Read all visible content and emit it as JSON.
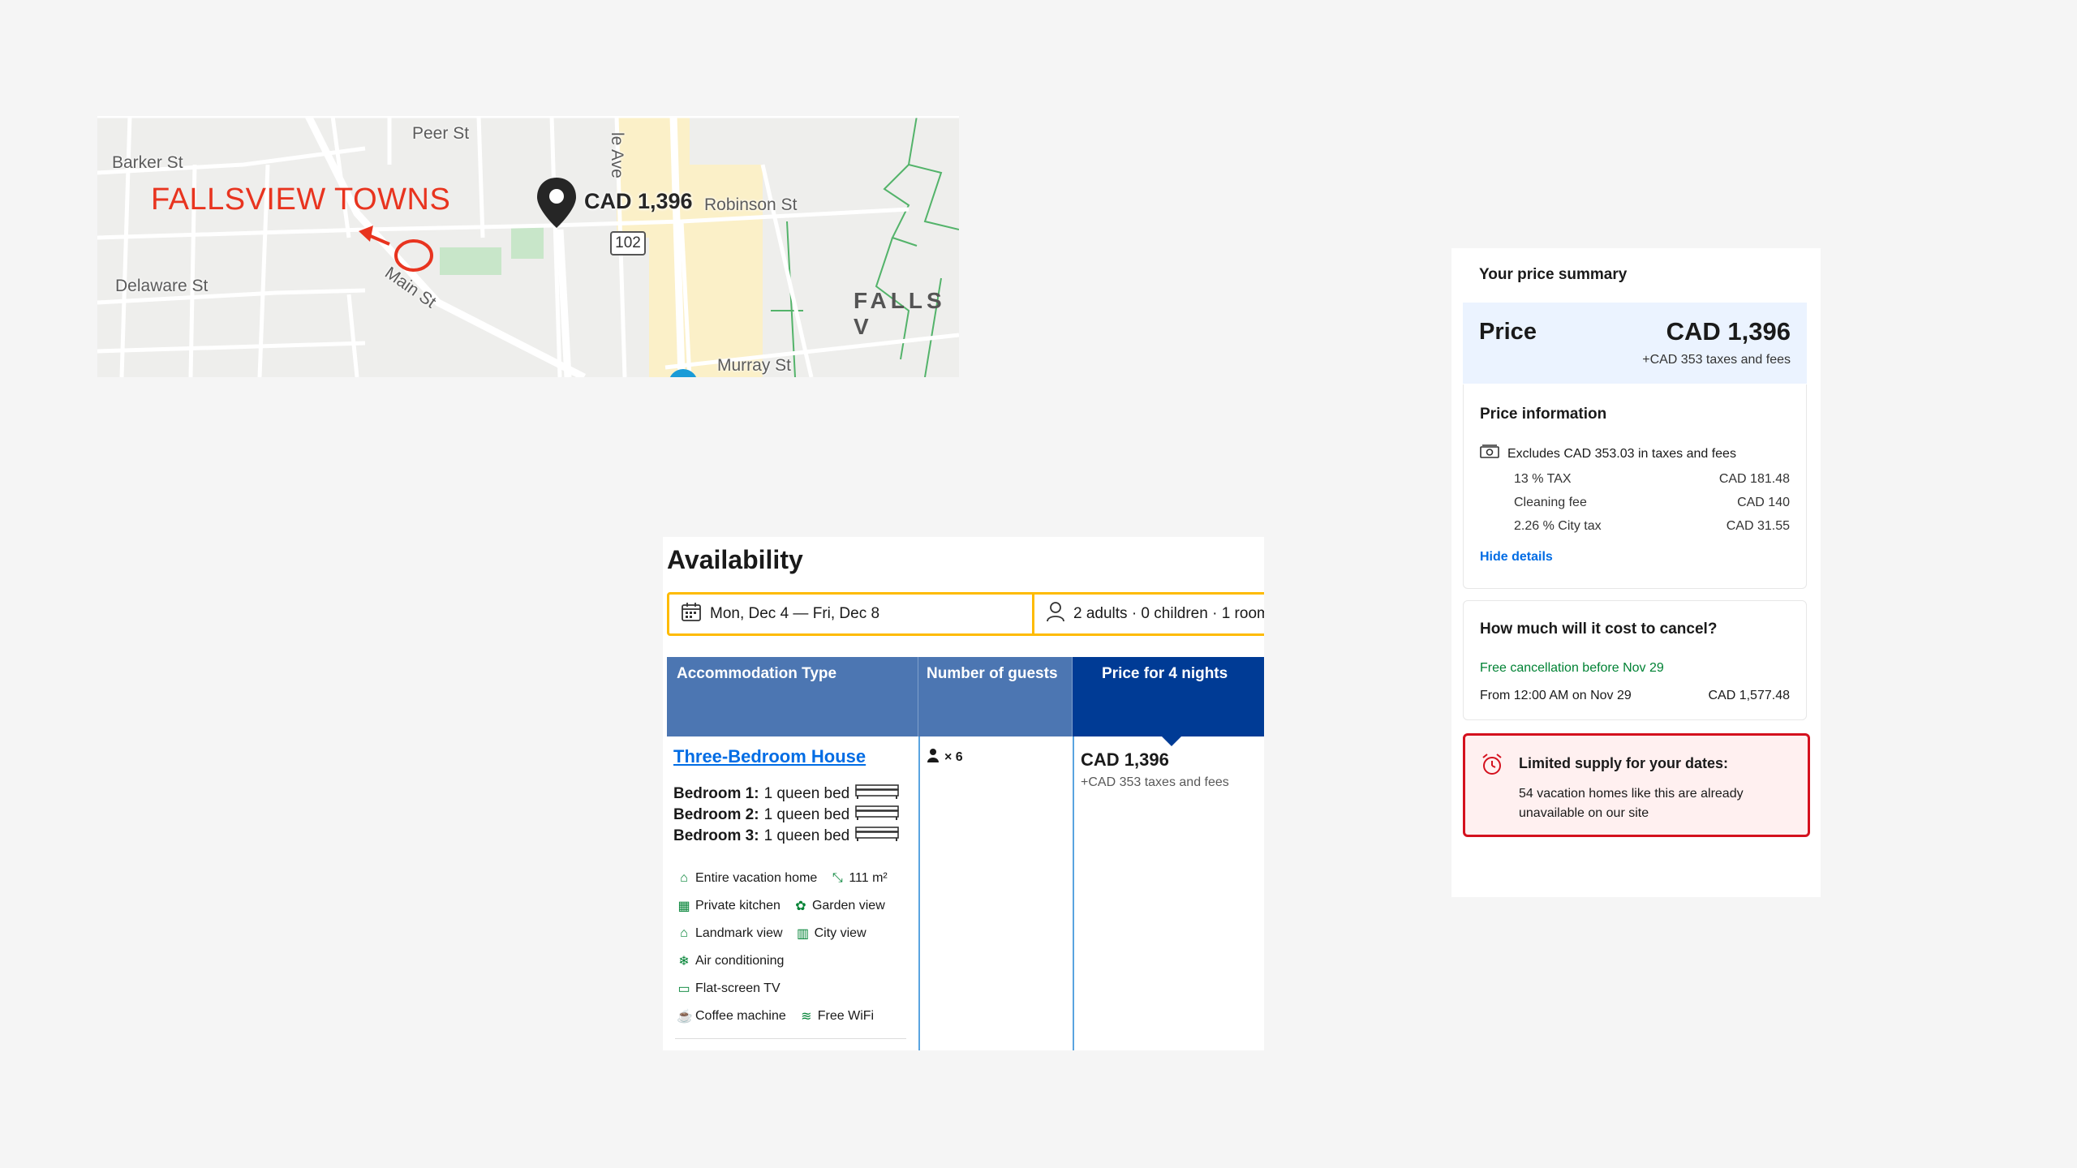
{
  "map": {
    "brand_label": "FALLSVIEW TOWNS",
    "price_label": "CAD 1,396",
    "route_number": "102",
    "area_label": "FALLS V",
    "streets": {
      "barker": "Barker St",
      "peer": "Peer St",
      "delaware": "Delaware St",
      "main": "Main St",
      "robinson": "Robinson St",
      "murray": "Murray St",
      "ave": "le Ave"
    },
    "colors": {
      "brand": "#e8341f",
      "park": "#c8e6c9",
      "beige": "#fbf0c8"
    }
  },
  "availability": {
    "title": "Availability",
    "dates": "Mon, Dec 4  —  Fri, Dec 8",
    "guests": "2 adults · 0 children · 1 room",
    "headers": {
      "type": "Accommodation Type",
      "guests": "Number of guests",
      "price": "Price for 4 nights"
    },
    "room": {
      "name": "Three-Bedroom House",
      "bedrooms": [
        {
          "label": "Bedroom 1:",
          "bed": "1 queen bed"
        },
        {
          "label": "Bedroom 2:",
          "bed": "1 queen bed"
        },
        {
          "label": "Bedroom 3:",
          "bed": "1 queen bed"
        }
      ],
      "amenities": {
        "entire": "Entire vacation home",
        "size": "111 m²",
        "kitchen": "Private kitchen",
        "garden": "Garden view",
        "landmark": "Landmark view",
        "city": "City view",
        "ac": "Air conditioning",
        "tv": "Flat-screen TV",
        "coffee": "Coffee machine",
        "wifi": "Free WiFi"
      },
      "guest_count": "× 6",
      "price": "CAD 1,396",
      "taxes": "+CAD 353 taxes and fees"
    }
  },
  "summary": {
    "title": "Your price summary",
    "price_label": "Price",
    "price_amount": "CAD 1,396",
    "price_taxes": "+CAD 353 taxes and fees",
    "info_title": "Price information",
    "excludes": "Excludes CAD 353.03 in taxes and fees",
    "fees": [
      {
        "name": "13 % TAX",
        "amount": "CAD 181.48"
      },
      {
        "name": "Cleaning fee",
        "amount": "CAD 140"
      },
      {
        "name": "2.26 % City tax",
        "amount": "CAD 31.55"
      }
    ],
    "hide_details": "Hide details",
    "cancel_title": "How much will it cost to cancel?",
    "free_cancel": "Free cancellation before Nov 29",
    "cancel_from": "From 12:00 AM on Nov 29",
    "cancel_amount": "CAD 1,577.48",
    "alert_title": "Limited supply for your dates:",
    "alert_desc": "54 vacation homes like this are already unavailable on our site"
  }
}
